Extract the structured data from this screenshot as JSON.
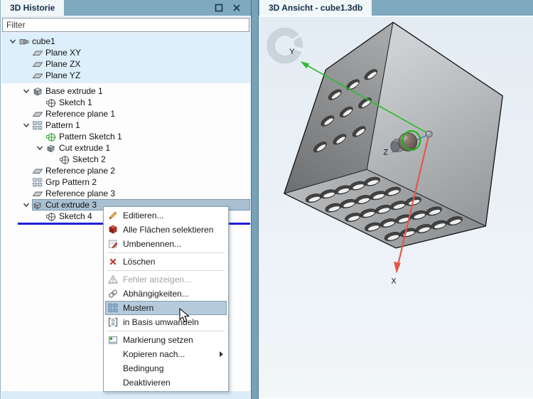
{
  "left_panel": {
    "title": "3D Historie",
    "window_buttons": {
      "maximize": "maximize",
      "close": "close"
    },
    "filter_value": "Filter",
    "tree": [
      {
        "label": "cube1",
        "icon": "part",
        "level": 0,
        "chevron": true
      },
      {
        "label": "Plane XY",
        "icon": "plane",
        "level": 1
      },
      {
        "label": "Plane ZX",
        "icon": "plane",
        "level": 1
      },
      {
        "label": "Plane YZ",
        "icon": "plane",
        "level": 1
      },
      {
        "label": "Base extrude 1",
        "icon": "extrude",
        "level": 1,
        "chevron": true,
        "gap_before": true
      },
      {
        "label": "Sketch 1",
        "icon": "sketch",
        "level": 2
      },
      {
        "label": "Reference plane 1",
        "icon": "plane",
        "level": 1
      },
      {
        "label": "Pattern 1",
        "icon": "pattern",
        "level": 1,
        "chevron": true
      },
      {
        "label": "Pattern Sketch 1",
        "icon": "sketch-green",
        "level": 2
      },
      {
        "label": "Cut extrude 1",
        "icon": "cut",
        "level": 2,
        "chevron": true
      },
      {
        "label": "Sketch 2",
        "icon": "sketch",
        "level": 3
      },
      {
        "label": "Reference plane 2",
        "icon": "plane",
        "level": 1
      },
      {
        "label": "Grp Pattern 2",
        "icon": "pattern",
        "level": 1
      },
      {
        "label": "Reference plane 3",
        "icon": "plane",
        "level": 1
      },
      {
        "label": "Cut extrude 3",
        "icon": "cut",
        "level": 1,
        "chevron": true,
        "selected": true
      },
      {
        "label": "Sketch 4",
        "icon": "sketch",
        "level": 2
      }
    ]
  },
  "context_menu": {
    "items": [
      {
        "label": "Editieren...",
        "icon": "edit"
      },
      {
        "label": "Alle Flächen selektieren",
        "icon": "faces"
      },
      {
        "label": "Umbenennen...",
        "icon": "rename",
        "separator_after": true
      },
      {
        "label": "Löschen",
        "icon": "delete",
        "separator_after": true
      },
      {
        "label": "Fehler anzeigen...",
        "icon": "warning",
        "disabled": true
      },
      {
        "label": "Abhängigkeiten...",
        "icon": "chain"
      },
      {
        "label": "Mustern",
        "icon": "patternblue",
        "highlighted": true
      },
      {
        "label": "in Basis umwandeln",
        "icon": "tobase",
        "separator_after": true
      },
      {
        "label": "Markierung setzen",
        "icon": "mark"
      },
      {
        "label": "Kopieren nach...",
        "icon": "none",
        "submenu": true
      },
      {
        "label": "Bedingung",
        "icon": "none"
      },
      {
        "label": "Deaktivieren",
        "icon": "none"
      }
    ]
  },
  "right_panel": {
    "tab_title": "3D Ansicht - cube1.3db",
    "axis_labels": {
      "x": "X",
      "y": "Y",
      "z": "Z"
    }
  },
  "colors": {
    "titlebar": "#7fa9be",
    "selection": "#a9c0d2",
    "menu_highlight": "#b5cbdc",
    "rollback_line": "#1f1fd6",
    "axis_x": "#e2574a",
    "axis_y": "#33bb33",
    "axis_z": "#5b7fd6",
    "feature_highlight": "#1db31d"
  }
}
